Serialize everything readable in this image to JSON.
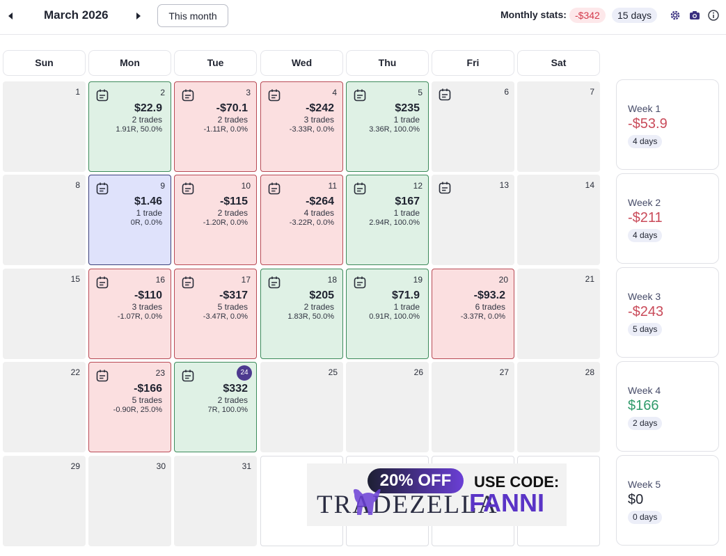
{
  "header": {
    "month_title": "March 2026",
    "this_month_label": "This month",
    "stats_label": "Monthly stats:",
    "monthly_pnl": "-$342",
    "monthly_days": "15 days",
    "icons": [
      "prev-arrow-icon",
      "next-arrow-icon",
      "gear-icon",
      "camera-icon",
      "info-icon"
    ]
  },
  "weekdays": [
    "Sun",
    "Mon",
    "Tue",
    "Wed",
    "Thu",
    "Fri",
    "Sat"
  ],
  "colors": {
    "win_bg": "#dff1e5",
    "win_border": "#3c8a5a",
    "loss_bg": "#fbdfe0",
    "loss_border": "#b84a55",
    "flat_bg": "#dfe2fb",
    "flat_border": "#3a3f7a",
    "negative_text": "#c94a59",
    "positive_text": "#2f9a6a",
    "today_badge": "#4d3a8f"
  },
  "days": [
    {
      "day": "1",
      "status": "none",
      "note": false
    },
    {
      "day": "2",
      "status": "win",
      "note": true,
      "pnl": "$22.9",
      "trades": "2 trades",
      "stats": "1.91R, 50.0%"
    },
    {
      "day": "3",
      "status": "loss",
      "note": true,
      "pnl": "-$70.1",
      "trades": "2 trades",
      "stats": "-1.11R, 0.0%"
    },
    {
      "day": "4",
      "status": "loss",
      "note": true,
      "pnl": "-$242",
      "trades": "3 trades",
      "stats": "-3.33R, 0.0%"
    },
    {
      "day": "5",
      "status": "win",
      "note": true,
      "pnl": "$235",
      "trades": "1 trade",
      "stats": "3.36R, 100.0%"
    },
    {
      "day": "6",
      "status": "none",
      "note": true
    },
    {
      "day": "7",
      "status": "none",
      "note": false
    },
    {
      "day": "8",
      "status": "none",
      "note": false
    },
    {
      "day": "9",
      "status": "flat",
      "note": true,
      "pnl": "$1.46",
      "trades": "1 trade",
      "stats": "0R, 0.0%"
    },
    {
      "day": "10",
      "status": "loss",
      "note": true,
      "pnl": "-$115",
      "trades": "2 trades",
      "stats": "-1.20R, 0.0%"
    },
    {
      "day": "11",
      "status": "loss",
      "note": true,
      "pnl": "-$264",
      "trades": "4 trades",
      "stats": "-3.22R, 0.0%"
    },
    {
      "day": "12",
      "status": "win",
      "note": true,
      "pnl": "$167",
      "trades": "1 trade",
      "stats": "2.94R, 100.0%"
    },
    {
      "day": "13",
      "status": "none",
      "note": true
    },
    {
      "day": "14",
      "status": "none",
      "note": false
    },
    {
      "day": "15",
      "status": "none",
      "note": false
    },
    {
      "day": "16",
      "status": "loss",
      "note": true,
      "pnl": "-$110",
      "trades": "3 trades",
      "stats": "-1.07R, 0.0%"
    },
    {
      "day": "17",
      "status": "loss",
      "note": true,
      "pnl": "-$317",
      "trades": "5 trades",
      "stats": "-3.47R, 0.0%"
    },
    {
      "day": "18",
      "status": "win",
      "note": true,
      "pnl": "$205",
      "trades": "2 trades",
      "stats": "1.83R, 50.0%"
    },
    {
      "day": "19",
      "status": "win",
      "note": true,
      "pnl": "$71.9",
      "trades": "1 trade",
      "stats": "0.91R, 100.0%"
    },
    {
      "day": "20",
      "status": "loss",
      "note": false,
      "pnl": "-$93.2",
      "trades": "6 trades",
      "stats": "-3.37R, 0.0%"
    },
    {
      "day": "21",
      "status": "none",
      "note": false
    },
    {
      "day": "22",
      "status": "none",
      "note": false
    },
    {
      "day": "23",
      "status": "loss",
      "note": true,
      "pnl": "-$166",
      "trades": "5 trades",
      "stats": "-0.90R, 25.0%"
    },
    {
      "day": "24",
      "status": "win",
      "note": true,
      "today": true,
      "pnl": "$332",
      "trades": "2 trades",
      "stats": "7R, 100.0%"
    },
    {
      "day": "25",
      "status": "future",
      "note": false
    },
    {
      "day": "26",
      "status": "future",
      "note": false
    },
    {
      "day": "27",
      "status": "future",
      "note": false
    },
    {
      "day": "28",
      "status": "future",
      "note": false
    },
    {
      "day": "29",
      "status": "none",
      "note": false
    },
    {
      "day": "30",
      "status": "none",
      "note": false
    },
    {
      "day": "31",
      "status": "none",
      "note": false
    },
    {
      "day": "",
      "status": "empty",
      "note": false
    },
    {
      "day": "",
      "status": "empty",
      "note": false
    },
    {
      "day": "",
      "status": "empty",
      "note": false
    },
    {
      "day": "",
      "status": "empty",
      "note": false
    }
  ],
  "weeks": [
    {
      "label": "Week 1",
      "pnl": "-$53.9",
      "sign": "neg",
      "days": "4 days"
    },
    {
      "label": "Week 2",
      "pnl": "-$211",
      "sign": "neg",
      "days": "4 days"
    },
    {
      "label": "Week 3",
      "pnl": "-$243",
      "sign": "neg",
      "days": "5 days"
    },
    {
      "label": "Week 4",
      "pnl": "$166",
      "sign": "pos",
      "days": "2 days"
    },
    {
      "label": "Week 5",
      "pnl": "$0",
      "sign": "zero",
      "days": "0 days"
    }
  ],
  "promo": {
    "discount": "20% OFF",
    "use_code": "USE CODE:",
    "brand": "TRADEZELLA",
    "code": "FANNI"
  }
}
